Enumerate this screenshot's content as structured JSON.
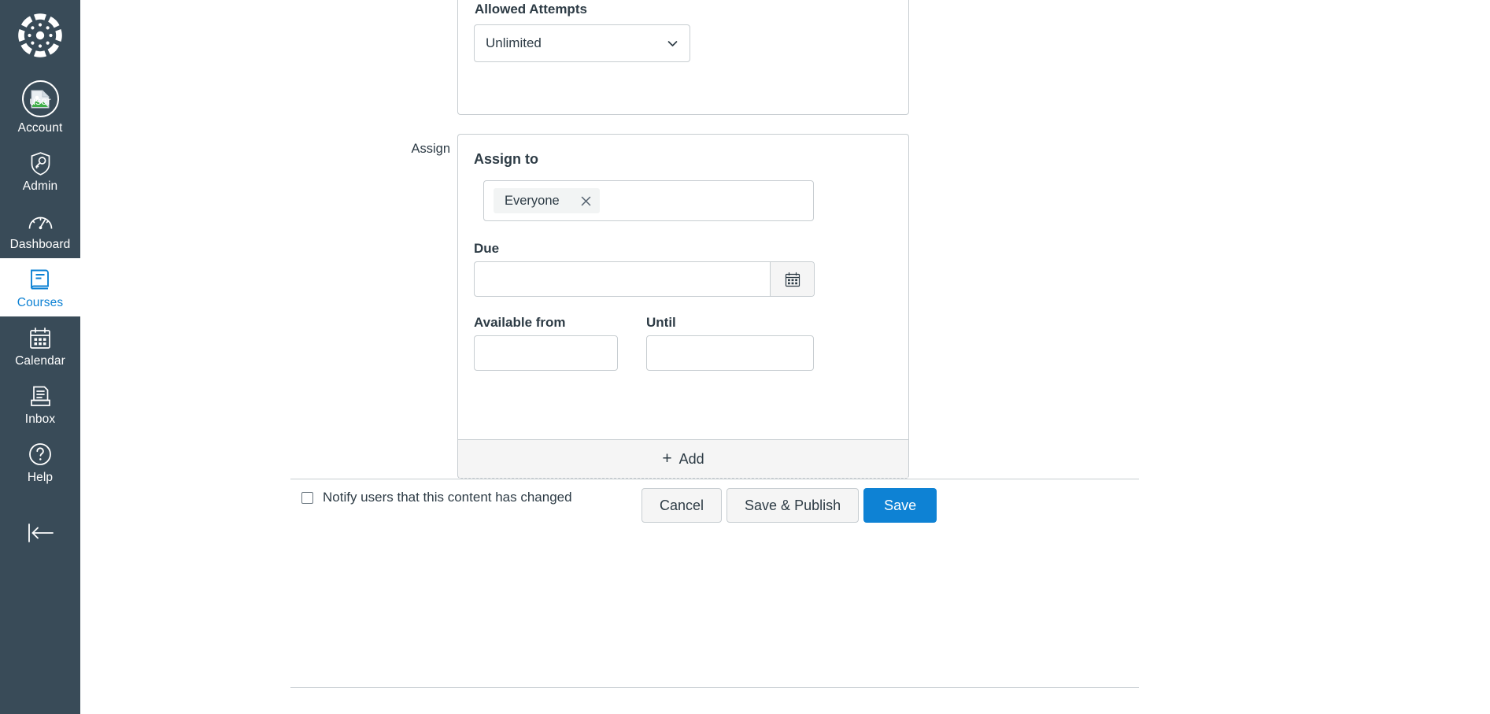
{
  "global_nav": {
    "logo_icon": "canvas-logo-icon",
    "collapse_icon": "collapse-arrow-icon",
    "items": [
      {
        "label": "Account",
        "icon": "user-avatar-icon",
        "avatar_alt": "user",
        "active": false
      },
      {
        "label": "Admin",
        "icon": "shield-key-icon",
        "active": false
      },
      {
        "label": "Dashboard",
        "icon": "dashboard-gauge-icon",
        "active": false
      },
      {
        "label": "Courses",
        "icon": "courses-book-icon",
        "active": true
      },
      {
        "label": "Calendar",
        "icon": "calendar-icon",
        "active": false
      },
      {
        "label": "Inbox",
        "icon": "inbox-tray-icon",
        "active": false
      },
      {
        "label": "Help",
        "icon": "question-circle-icon",
        "active": false
      }
    ],
    "active_color": "#0e82d4",
    "background": "#394B58"
  },
  "attempts": {
    "label": "Allowed Attempts",
    "select_value": "Unlimited",
    "select_icon": "chevron-down-icon"
  },
  "assign": {
    "row_label": "Assign",
    "heading": "Assign to",
    "tokens": [
      {
        "label": "Everyone",
        "remove_icon": "close-x-icon"
      }
    ],
    "token_placeholder": "",
    "due": {
      "label": "Due",
      "value": "",
      "placeholder": "",
      "calendar_icon": "calendar-icon"
    },
    "available_from": {
      "label": "Available from",
      "value": "",
      "placeholder": "",
      "calendar_icon": "calendar-icon"
    },
    "until": {
      "label": "Until",
      "value": "",
      "placeholder": "",
      "calendar_icon": "calendar-icon"
    },
    "add_label": "Add",
    "add_icon": "plus-icon"
  },
  "footer": {
    "notify_label": "Notify users that this content has changed",
    "notify_checked": false,
    "cancel_label": "Cancel",
    "save_publish_label": "Save & Publish",
    "save_label": "Save",
    "primary_color": "#0E82D4"
  }
}
